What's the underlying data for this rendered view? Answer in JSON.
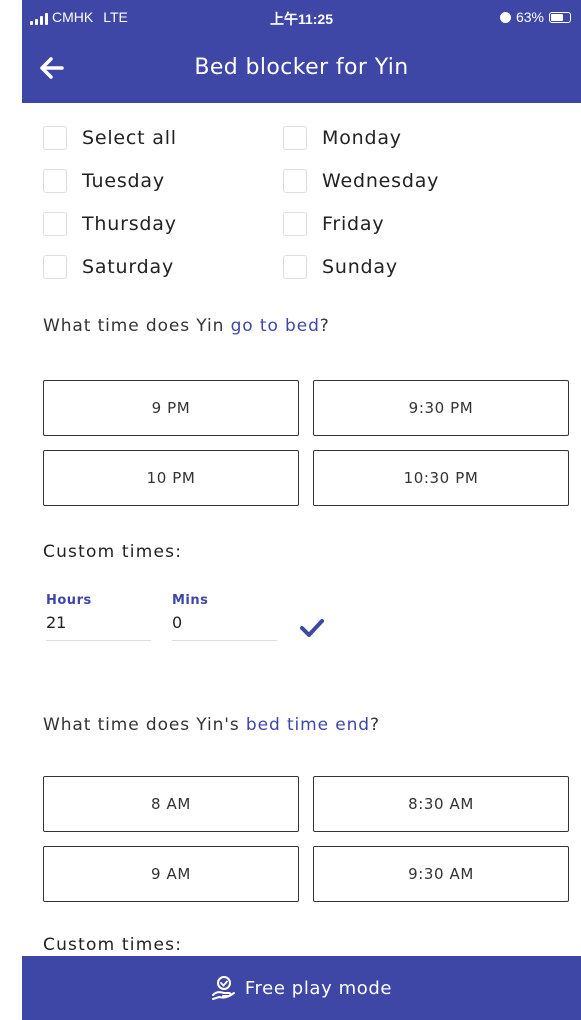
{
  "status_bar": {
    "carrier": "CMHK",
    "network": "LTE",
    "time": "上午11:25",
    "battery": "63%"
  },
  "app_bar": {
    "title": "Bed blocker for Yin",
    "back_icon": "arrow-left-icon"
  },
  "days": {
    "items": [
      {
        "label": "Select all",
        "checked": false
      },
      {
        "label": "Monday",
        "checked": false
      },
      {
        "label": "Tuesday",
        "checked": false
      },
      {
        "label": "Wednesday",
        "checked": false
      },
      {
        "label": "Thursday",
        "checked": false
      },
      {
        "label": "Friday",
        "checked": false
      },
      {
        "label": "Saturday",
        "checked": false
      },
      {
        "label": "Sunday",
        "checked": false
      }
    ]
  },
  "bedtime": {
    "question_prefix": "What time does Yin ",
    "question_highlight": "go to bed",
    "question_suffix": "?",
    "options": [
      "9 PM",
      "9:30 PM",
      "10 PM",
      "10:30 PM"
    ],
    "custom_label": "Custom times:",
    "hours_label": "Hours",
    "hours_value": "21",
    "mins_label": "Mins",
    "mins_value": "0",
    "confirm_icon": "checkmark-icon"
  },
  "bedtime_end": {
    "question_prefix": "What time does Yin's ",
    "question_highlight": "bed time end",
    "question_suffix": "?",
    "options": [
      "8 AM",
      "8:30 AM",
      "9 AM",
      "9:30 AM"
    ],
    "custom_label": "Custom times:"
  },
  "bottom_bar": {
    "label": "Free play mode",
    "icon": "hand-clock-icon"
  },
  "colors": {
    "primary": "#3f47a6",
    "text": "#222222",
    "checkbox_border": "#dddddd"
  }
}
